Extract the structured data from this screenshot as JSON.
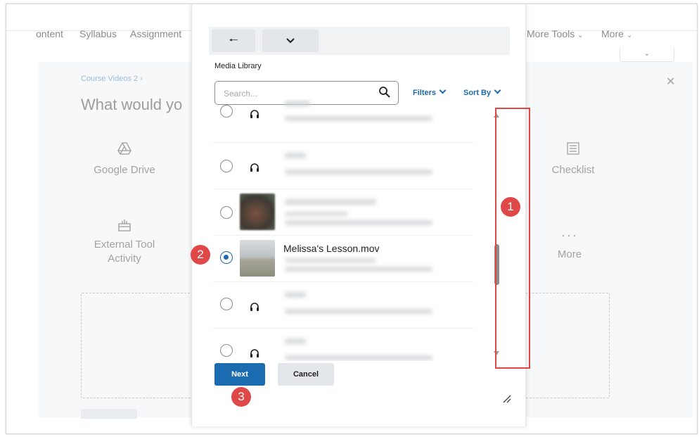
{
  "nav": {
    "items": [
      "ontent",
      "Syllabus",
      "Assignment"
    ],
    "more_tools": "More Tools",
    "more": "More"
  },
  "background": {
    "breadcrumb": "Course Videos 2 ›",
    "title": "What would yo",
    "tiles": [
      {
        "label": "Google Drive",
        "icon": "google-drive-icon"
      },
      {
        "label": "Checklist",
        "icon": "checklist-icon"
      },
      {
        "label": "External Tool Activity",
        "icon": "external-tool-icon"
      },
      {
        "label": "More",
        "icon": "more-icon"
      }
    ]
  },
  "modal": {
    "section_label": "Media Library",
    "search_placeholder": "Search...",
    "filters_label": "Filters",
    "sort_label": "Sort By",
    "items": [
      {
        "title": "",
        "icon": "audio-icon",
        "selected": false
      },
      {
        "title": "",
        "icon": "audio-icon",
        "selected": false
      },
      {
        "title": "",
        "icon": "video-thumbnail",
        "selected": false
      },
      {
        "title": "Melissa's Lesson.mov",
        "icon": "video-thumbnail",
        "selected": true
      },
      {
        "title": "",
        "icon": "audio-icon",
        "selected": false
      },
      {
        "title": "",
        "icon": "audio-icon",
        "selected": false
      }
    ],
    "next_label": "Next",
    "cancel_label": "Cancel"
  },
  "annotations": [
    "1",
    "2",
    "3"
  ],
  "colors": {
    "accent": "#1a6bb0",
    "annotation_red": "#e04848"
  }
}
